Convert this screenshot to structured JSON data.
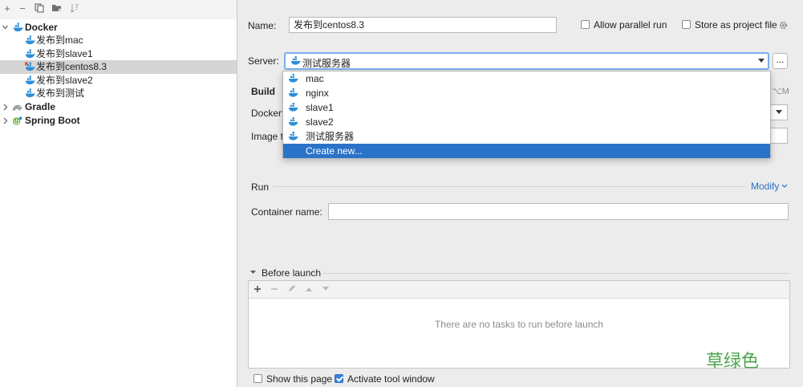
{
  "toolbar": {
    "icons": [
      "add-icon",
      "remove-icon",
      "copy-icon",
      "folder-icon",
      "sort-icon"
    ],
    "add": "+",
    "remove": "−"
  },
  "tree": {
    "docker": {
      "label": "Docker"
    },
    "docker_children": [
      {
        "label": "发布到mac"
      },
      {
        "label": "发布到slave1"
      },
      {
        "label": "发布到centos8.3"
      },
      {
        "label": "发布到slave2"
      },
      {
        "label": "发布到测试"
      }
    ],
    "gradle": {
      "label": "Gradle"
    },
    "springboot": {
      "label": "Spring Boot"
    }
  },
  "form": {
    "name_label": "Name:",
    "name_value": "发布到centos8.3",
    "allow_parallel": "Allow parallel run",
    "store_project": "Store as project file",
    "server_label": "Server:",
    "server_value": "测试服务器",
    "dots": "...",
    "build_label": "Build",
    "shortcut_fragment": "⌥M",
    "dockerfile_label": "Dockerfile",
    "image_label": "Image tag",
    "run_label": "Run",
    "modify_label": "Modify",
    "container_label": "Container name:",
    "before_launch": "Before launch",
    "no_tasks": "There are no tasks to run before launch",
    "show_page": "Show this page",
    "activate_window": "Activate tool window"
  },
  "dropdown": {
    "items": [
      "mac",
      "nginx",
      "slave1",
      "slave2",
      "测试服务器"
    ],
    "create_new": "Create new..."
  },
  "watermark": "草绿色",
  "colors": {
    "selection": "#2b73c9",
    "link": "#2d6fc4",
    "watermark": "#4ca64c",
    "docker_blue": "#2d8fd8",
    "checkbox_blue": "#3a7fe0"
  }
}
